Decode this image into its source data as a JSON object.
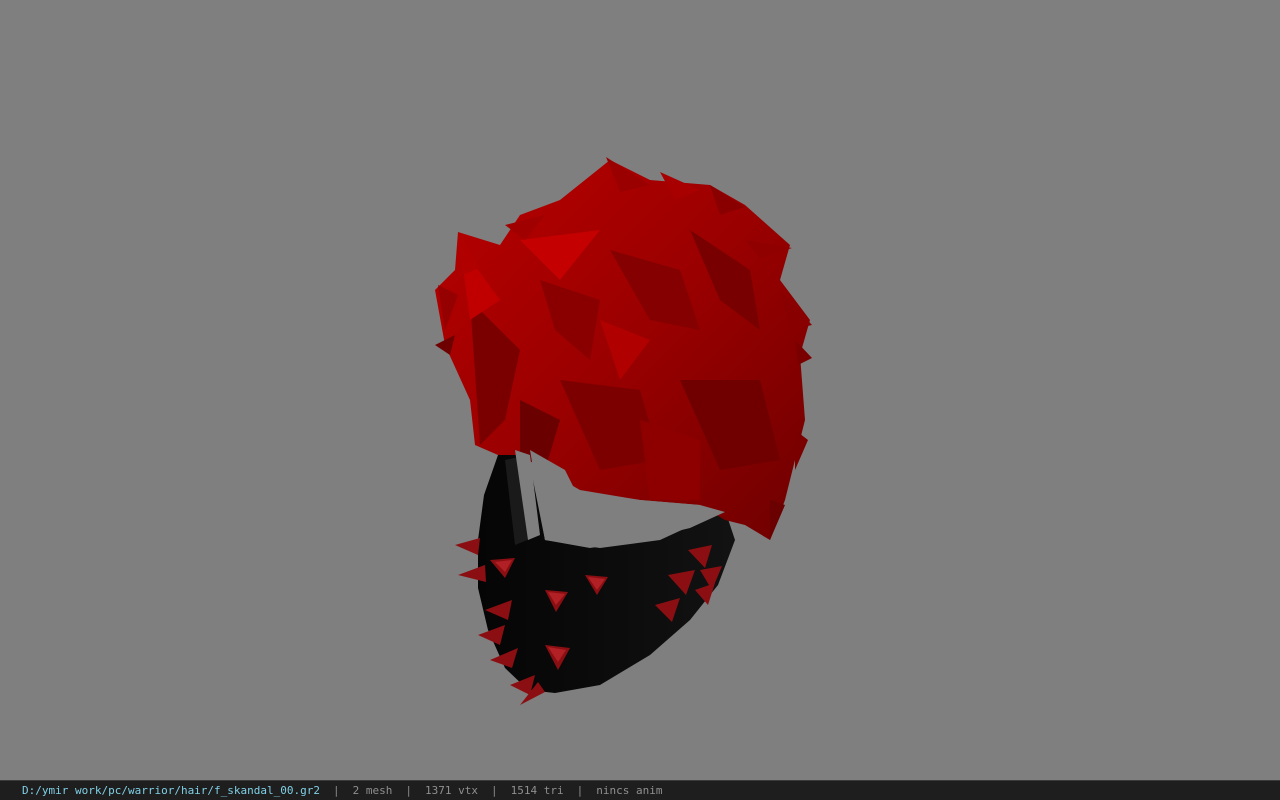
{
  "viewer": {
    "background_color": "#7f7f7f",
    "model": {
      "name": "hair-with-spiked-mask",
      "hair_color": "#a30000",
      "mask_color": "#0a0a0a",
      "spike_color": "#8b0f12"
    }
  },
  "status_bar": {
    "file_path": "D:/ymir work/pc/warrior/hair/f_skandal_00.gr2",
    "separator": "|",
    "mesh_count": "2 mesh",
    "vertex_count": "1371 vtx",
    "triangle_count": "1514 tri",
    "animation": "nincs anim"
  }
}
